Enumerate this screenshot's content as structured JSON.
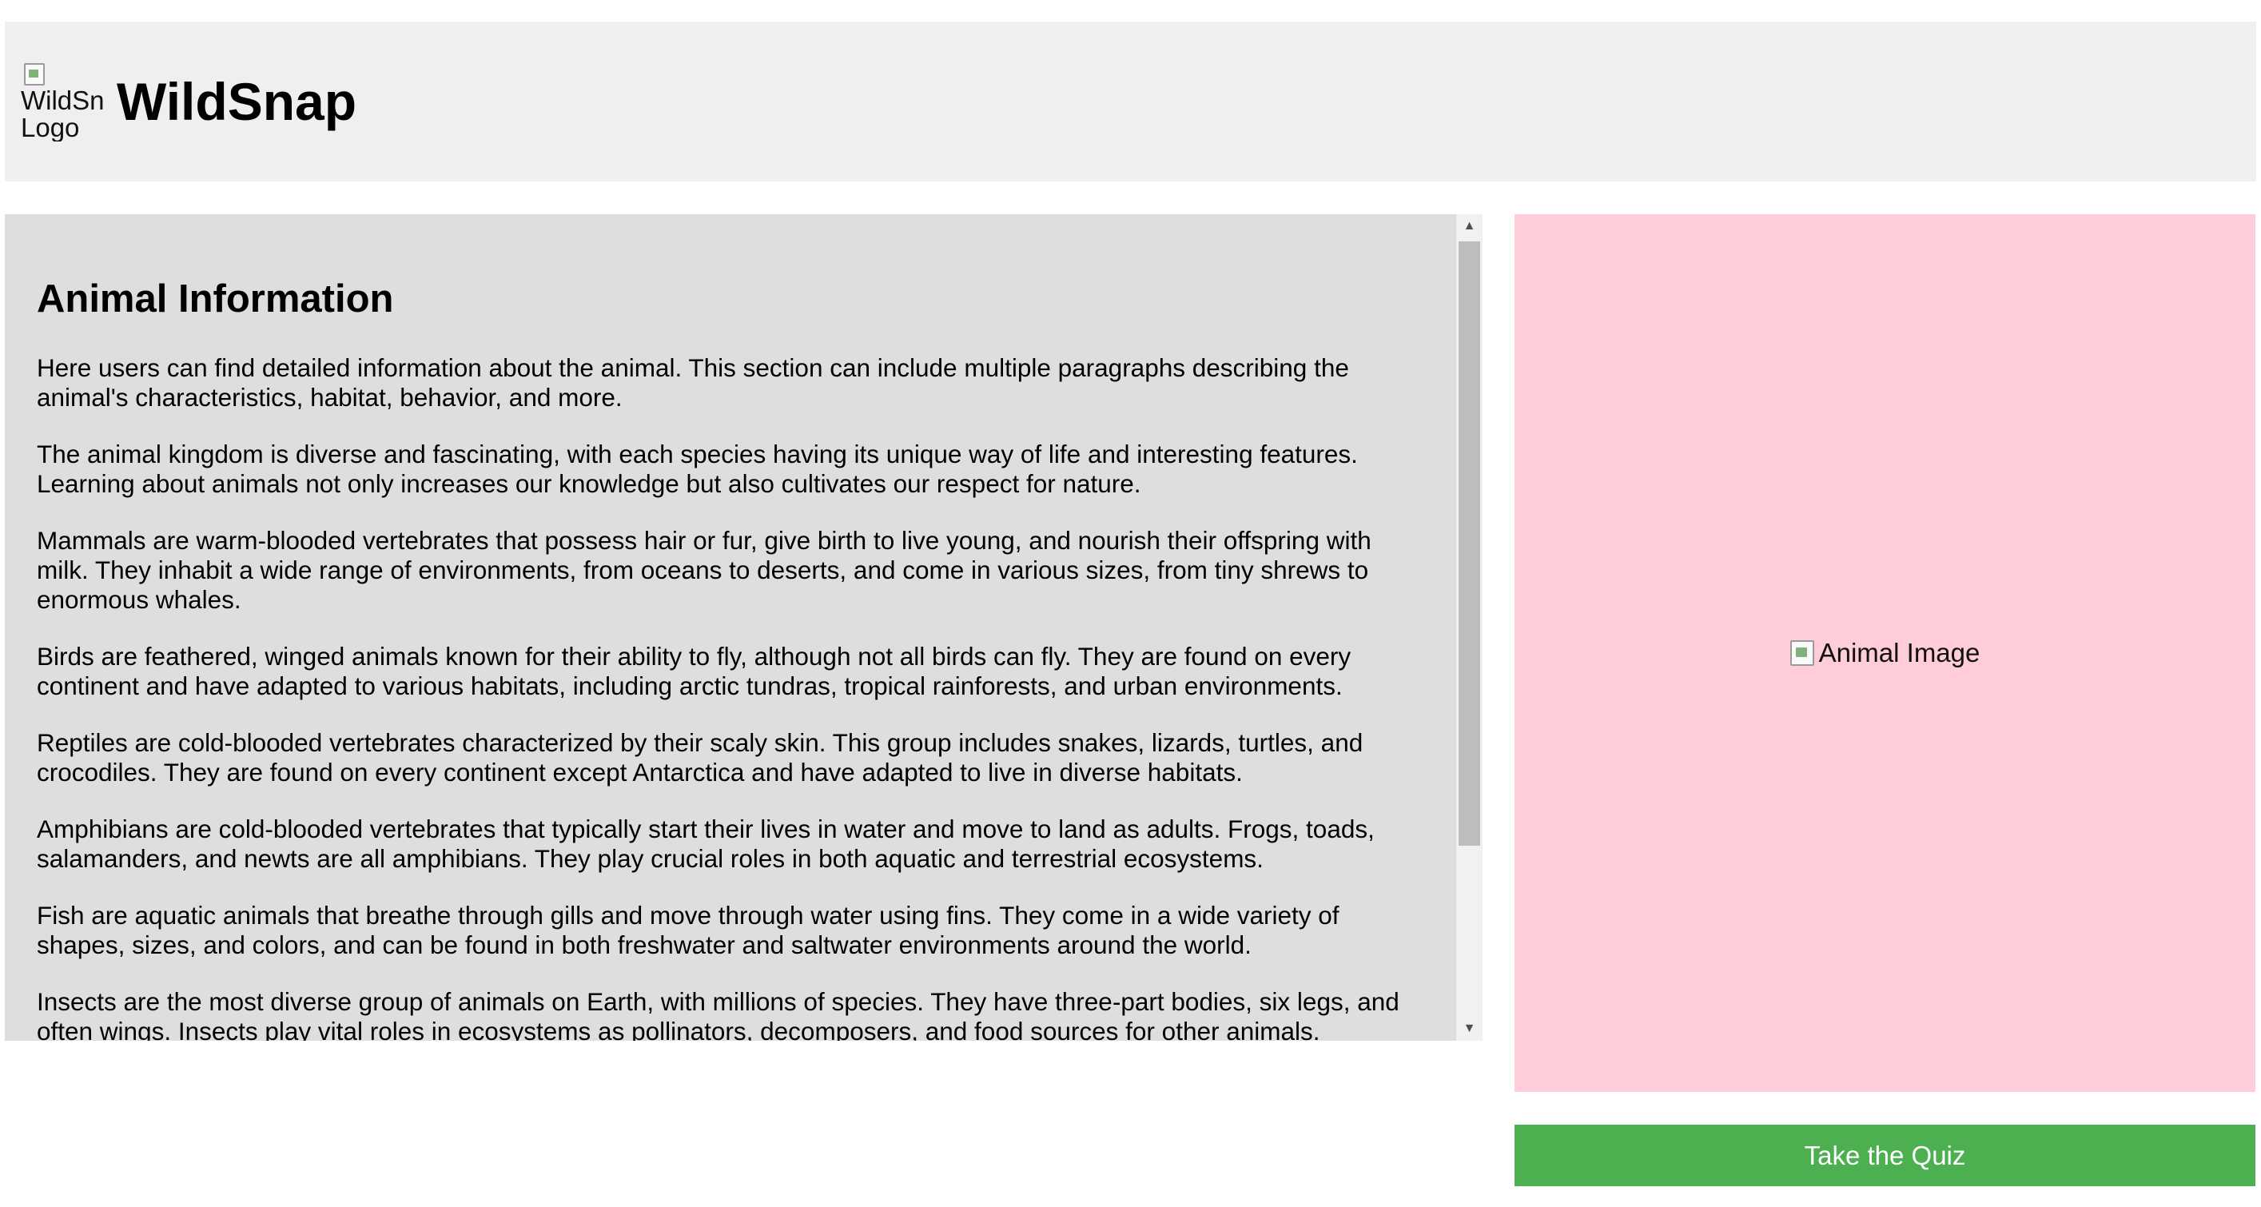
{
  "header": {
    "logo_alt": "WildSnap Logo",
    "title": "WildSnap"
  },
  "info": {
    "heading": "Animal Information",
    "paragraphs": [
      "Here users can find detailed information about the animal. This section can include multiple paragraphs describing the animal's characteristics, habitat, behavior, and more.",
      "The animal kingdom is diverse and fascinating, with each species having its unique way of life and interesting features. Learning about animals not only increases our knowledge but also cultivates our respect for nature.",
      "Mammals are warm-blooded vertebrates that possess hair or fur, give birth to live young, and nourish their offspring with milk. They inhabit a wide range of environments, from oceans to deserts, and come in various sizes, from tiny shrews to enormous whales.",
      "Birds are feathered, winged animals known for their ability to fly, although not all birds can fly. They are found on every continent and have adapted to various habitats, including arctic tundras, tropical rainforests, and urban environments.",
      "Reptiles are cold-blooded vertebrates characterized by their scaly skin. This group includes snakes, lizards, turtles, and crocodiles. They are found on every continent except Antarctica and have adapted to live in diverse habitats.",
      "Amphibians are cold-blooded vertebrates that typically start their lives in water and move to land as adults. Frogs, toads, salamanders, and newts are all amphibians. They play crucial roles in both aquatic and terrestrial ecosystems.",
      "Fish are aquatic animals that breathe through gills and move through water using fins. They come in a wide variety of shapes, sizes, and colors, and can be found in both freshwater and saltwater environments around the world.",
      "Insects are the most diverse group of animals on Earth, with millions of species. They have three-part bodies, six legs, and often wings. Insects play vital roles in ecosystems as pollinators, decomposers, and food sources for other animals."
    ]
  },
  "image_panel": {
    "alt": "Animal Image"
  },
  "quiz": {
    "button_label": "Take the Quiz"
  },
  "icons": {
    "scroll_up": "scroll-up-arrow-icon",
    "scroll_down": "scroll-down-arrow-icon",
    "broken_image": "broken-image-icon"
  },
  "colors": {
    "header_bg": "#efefef",
    "info_bg": "#dedede",
    "image_bg": "#ffcdd9",
    "button_bg": "#4caf50",
    "button_text": "#ffffff"
  }
}
